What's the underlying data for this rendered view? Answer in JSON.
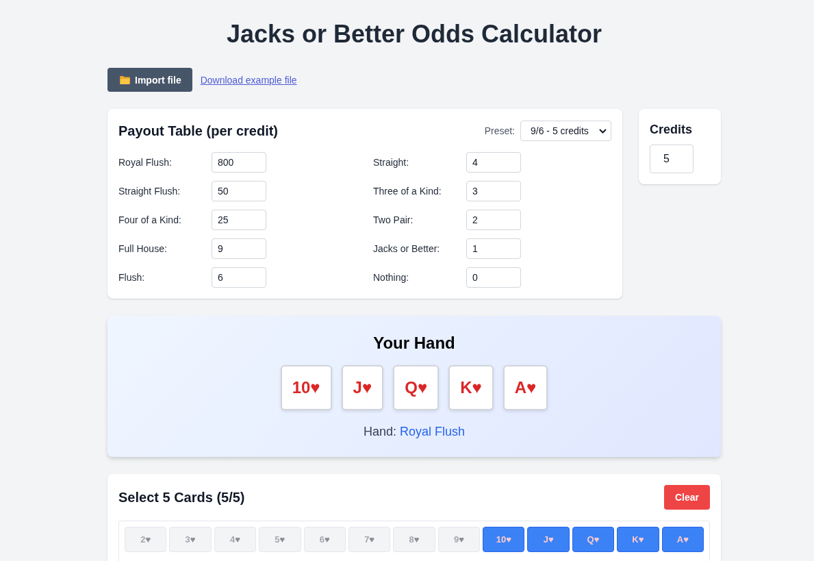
{
  "title": "Jacks or Better Odds Calculator",
  "toolbar": {
    "import_button": "Import file",
    "download_link": "Download example file"
  },
  "payout_table": {
    "title": "Payout Table (per credit)",
    "preset": {
      "label": "Preset:",
      "value": "9/6 - 5 credits"
    },
    "rows": [
      {
        "label": "Royal Flush:",
        "value": "800"
      },
      {
        "label": "Straight Flush:",
        "value": "50"
      },
      {
        "label": "Four of a Kind:",
        "value": "25"
      },
      {
        "label": "Full House:",
        "value": "9"
      },
      {
        "label": "Flush:",
        "value": "6"
      },
      {
        "label": "Straight:",
        "value": "4"
      },
      {
        "label": "Three of a Kind:",
        "value": "3"
      },
      {
        "label": "Two Pair:",
        "value": "2"
      },
      {
        "label": "Jacks or Better:",
        "value": "1"
      },
      {
        "label": "Nothing:",
        "value": "0"
      }
    ]
  },
  "credits": {
    "title": "Credits",
    "value": "5"
  },
  "hand": {
    "title": "Your Hand",
    "cards": [
      {
        "rank": "10",
        "suit": "♥"
      },
      {
        "rank": "J",
        "suit": "♥"
      },
      {
        "rank": "Q",
        "suit": "♥"
      },
      {
        "rank": "K",
        "suit": "♥"
      },
      {
        "rank": "A",
        "suit": "♥"
      }
    ],
    "result_label": "Hand:",
    "result_value": "Royal Flush"
  },
  "card_picker": {
    "title": "Select 5 Cards (5/5)",
    "clear_button": "Clear",
    "cards": [
      {
        "rank": "2",
        "suit": "♥",
        "selected": false
      },
      {
        "rank": "3",
        "suit": "♥",
        "selected": false
      },
      {
        "rank": "4",
        "suit": "♥",
        "selected": false
      },
      {
        "rank": "5",
        "suit": "♥",
        "selected": false
      },
      {
        "rank": "6",
        "suit": "♥",
        "selected": false
      },
      {
        "rank": "7",
        "suit": "♥",
        "selected": false
      },
      {
        "rank": "8",
        "suit": "♥",
        "selected": false
      },
      {
        "rank": "9",
        "suit": "♥",
        "selected": false
      },
      {
        "rank": "10",
        "suit": "♥",
        "selected": true
      },
      {
        "rank": "J",
        "suit": "♥",
        "selected": true
      },
      {
        "rank": "Q",
        "suit": "♥",
        "selected": true
      },
      {
        "rank": "K",
        "suit": "♥",
        "selected": true
      },
      {
        "rank": "A",
        "suit": "♥",
        "selected": true
      }
    ]
  }
}
